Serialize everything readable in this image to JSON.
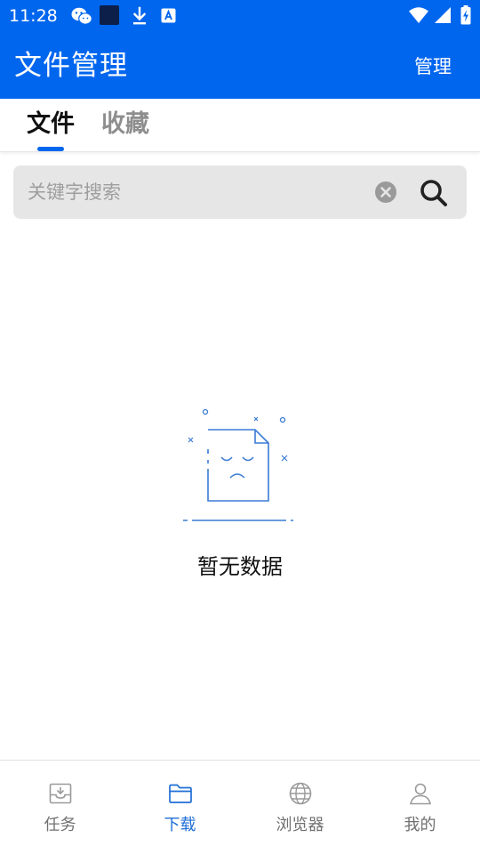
{
  "status_bar": {
    "time": "11:28",
    "icons": [
      "wechat-icon",
      "square-app-icon",
      "download-icon",
      "a-badge-icon",
      "wifi-icon",
      "signal-icon",
      "battery-charging-icon"
    ]
  },
  "header": {
    "title": "文件管理",
    "manage_label": "管理"
  },
  "tabs": [
    {
      "label": "文件",
      "active": true
    },
    {
      "label": "收藏",
      "active": false
    }
  ],
  "search": {
    "placeholder": "关键字搜索",
    "value": ""
  },
  "empty_state": {
    "message": "暂无数据",
    "icon": "empty-document-icon"
  },
  "bottom_nav": [
    {
      "label": "任务",
      "icon": "inbox-download-icon",
      "active": false
    },
    {
      "label": "下载",
      "icon": "folder-icon",
      "active": true
    },
    {
      "label": "浏览器",
      "icon": "globe-icon",
      "active": false
    },
    {
      "label": "我的",
      "icon": "person-icon",
      "active": false
    }
  ],
  "colors": {
    "primary": "#0066ee",
    "active_nav": "#1f6fd6",
    "inactive_nav": "#707070",
    "search_bg": "#e6e6e6",
    "illustration": "#3a7bd5"
  }
}
